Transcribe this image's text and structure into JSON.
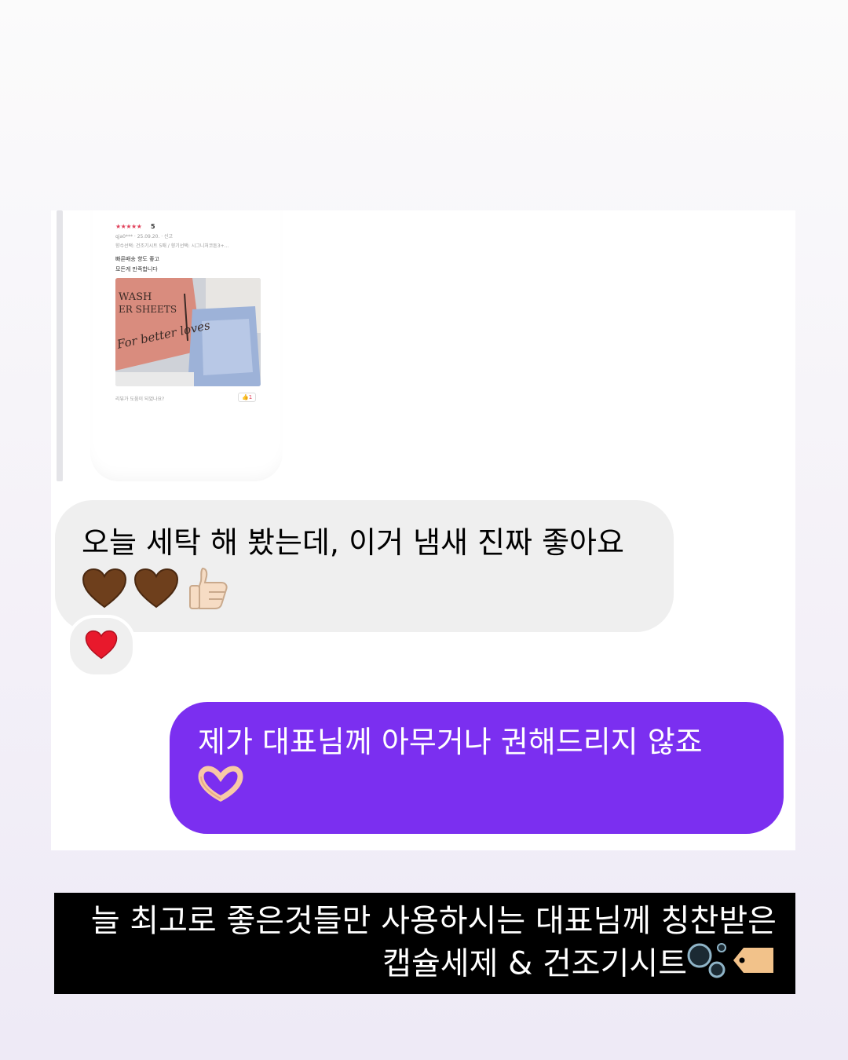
{
  "review": {
    "stars": "★★★★★",
    "score": "5",
    "meta": "qja0*** · 25.09.20. · 신고",
    "option": "향수선택: 건조기시트 5매 / 향기선택: 시그니처코튼3+...",
    "body_line1": "빠른배송 향도 좋고",
    "body_line2": "모든게 만족합니다",
    "package_line1": "WASH",
    "package_line2": "ER SHEETS",
    "package_script": "For better loves",
    "helpful": "리뷰가 도움이 되었나요?",
    "like_count": "1"
  },
  "messages": [
    {
      "direction": "incoming",
      "text": "오늘 세탁 해 봤는데, 이거 냄새 진짜 좋아요",
      "emojis": [
        "brown-heart",
        "brown-heart",
        "thumbs-up"
      ],
      "reaction": "red-heart"
    },
    {
      "direction": "outgoing",
      "text": "제가 대표님께 아무거나 권해드리지 않죠",
      "emojis": [
        "heart-hands"
      ]
    }
  ],
  "caption": {
    "line1": "늘 최고로 좋은것들만 사용하시는  대표님께 칭찬받은",
    "line2": "캡슐세제 & 건조기시트",
    "emojis": [
      "bubbles",
      "label-tag"
    ]
  },
  "colors": {
    "incoming_bubble": "#efefef",
    "outgoing_bubble": "#7b2ff0",
    "caption_bg": "#000000",
    "package_pink": "#d98c7e"
  }
}
